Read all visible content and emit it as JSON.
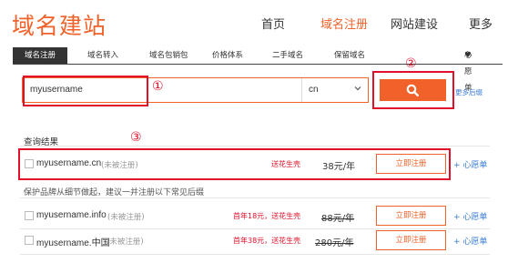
{
  "header": {
    "logo": "域名建站",
    "nav": [
      "首页",
      "域名注册",
      "网站建设",
      "更多"
    ]
  },
  "subnav": {
    "items": [
      "域名注册",
      "域名转入",
      "域名包销包",
      "价格体系",
      "二手域名",
      "保留域名"
    ],
    "wishlist": "心愿单"
  },
  "search": {
    "value": "myusername",
    "tld": "cn",
    "more_suffix": "更多后缀"
  },
  "annotations": [
    "①",
    "②",
    "③"
  ],
  "results": {
    "title": "查询结果",
    "primary": {
      "domain": "myusername.cn",
      "status": "(未被注册)",
      "promo": "送花生壳",
      "price": "38元/年",
      "register": "立即注册",
      "wish": "+ 心愿单"
    },
    "hint": "保护品牌从细节做起，建议一并注册以下常见后缀",
    "others": [
      {
        "domain": "myusername.info",
        "status": "(未被注册)",
        "promo": "首年18元，送花生壳",
        "old_price": "88元/年",
        "register": "立即注册",
        "wish": "+ 心愿单"
      },
      {
        "domain": "myusername.中国",
        "status": "(未被注册)",
        "promo": "首年38元，送花生壳",
        "old_price": "280元/年",
        "register": "立即注册",
        "wish": "+ 心愿单"
      }
    ]
  },
  "colors": {
    "brand": "#f0622a",
    "annotation": "#e0102a",
    "link": "#3a7bd5"
  }
}
